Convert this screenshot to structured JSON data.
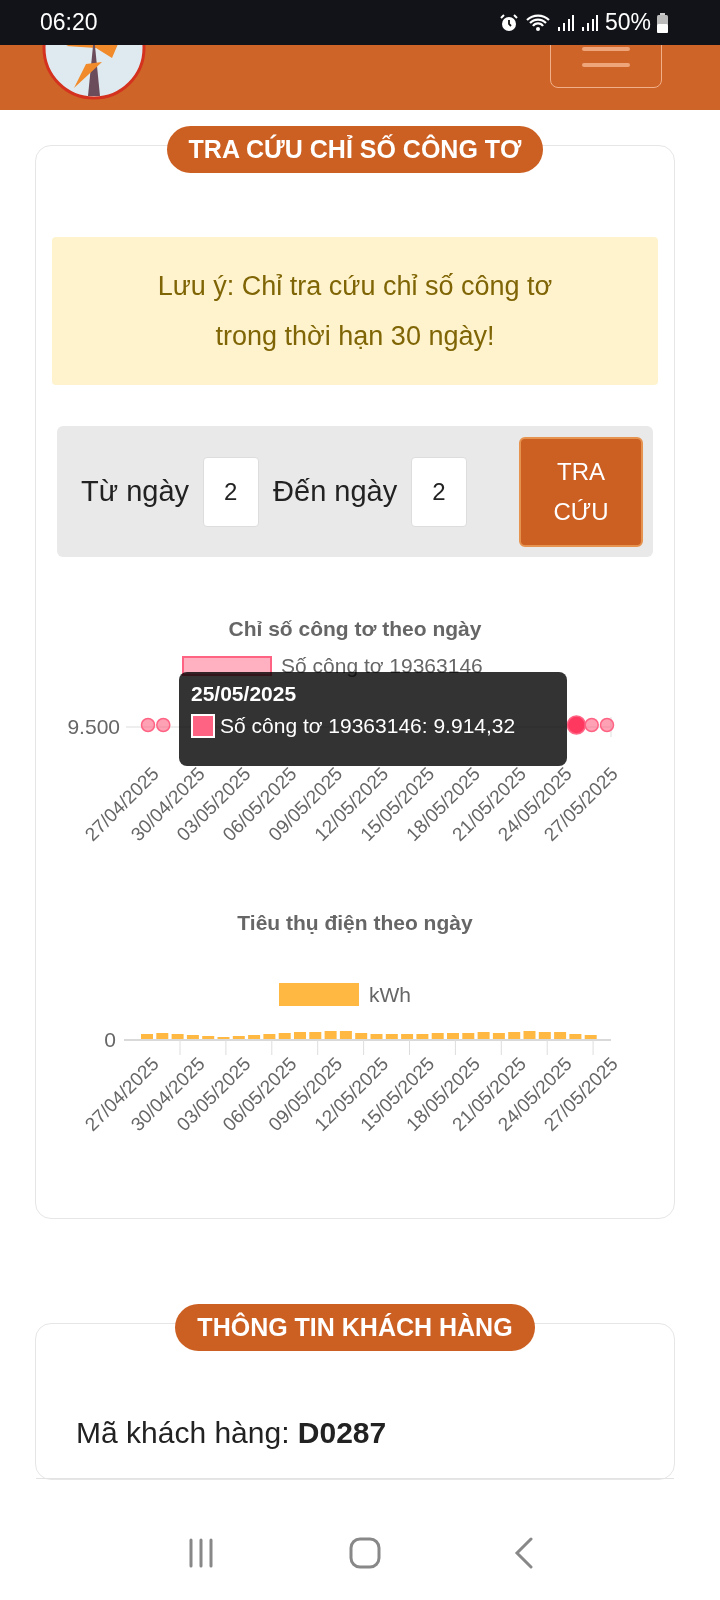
{
  "status_bar": {
    "time": "06:20",
    "battery": "50%"
  },
  "search_card": {
    "title": "TRA CỨU CHỈ SỐ CÔNG TƠ",
    "notice": "Lưu ý: Chỉ tra cứu chỉ số công tơ trong thời hạn 30 ngày!",
    "from_label": "Từ ngày",
    "from_value": "2",
    "to_label": "Đến ngày",
    "to_value": "2",
    "search_button": "TRA CỨU"
  },
  "meter_chart": {
    "title": "Chỉ số công tơ theo ngày",
    "legend": "Số công tơ 19363146",
    "y_tick": "9.500",
    "x_labels": [
      "27/04/2025",
      "30/04/2025",
      "03/05/2025",
      "06/05/2025",
      "09/05/2025",
      "12/05/2025",
      "15/05/2025",
      "18/05/2025",
      "21/05/2025",
      "24/05/2025",
      "27/05/2025"
    ],
    "tooltip": {
      "title": "25/05/2025",
      "text": "Số công tơ 19363146: 9.914,32"
    }
  },
  "usage_chart": {
    "title": "Tiêu thụ điện theo ngày",
    "legend": "kWh",
    "y_tick": "0",
    "x_labels": [
      "27/04/2025",
      "30/04/2025",
      "03/05/2025",
      "06/05/2025",
      "09/05/2025",
      "12/05/2025",
      "15/05/2025",
      "18/05/2025",
      "21/05/2025",
      "24/05/2025",
      "27/05/2025"
    ]
  },
  "customer_card": {
    "title": "THÔNG TIN KHÁCH HÀNG",
    "rows": [
      "Mã khách hàng: **D0287**"
    ]
  }
}
